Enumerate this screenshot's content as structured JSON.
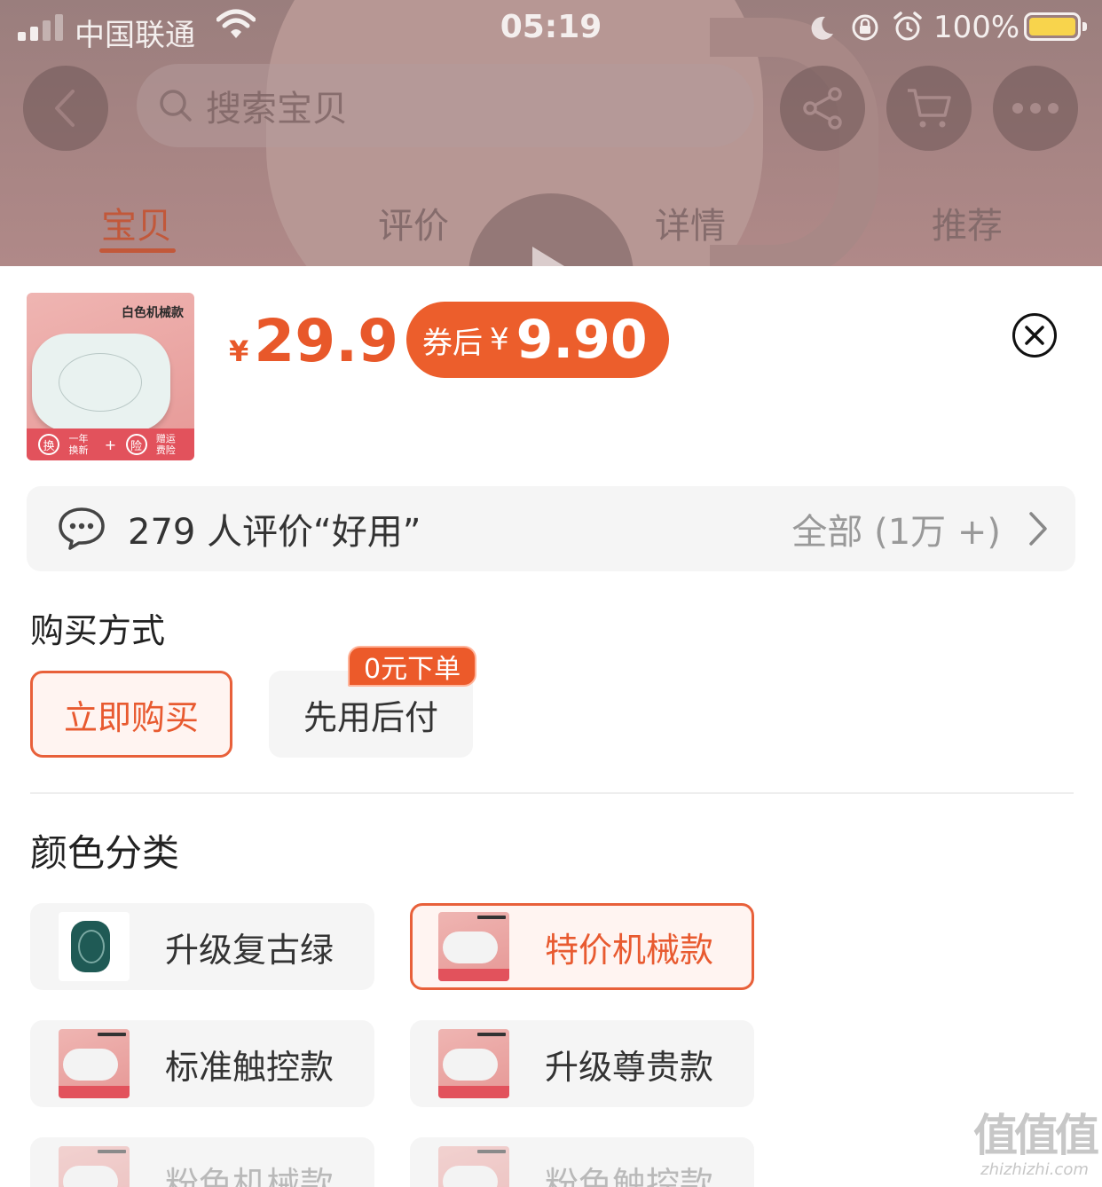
{
  "status_bar": {
    "carrier": "中国联通",
    "time": "05:19",
    "battery_percent": "100%"
  },
  "nav": {
    "search_placeholder": "搜索宝贝"
  },
  "tabs": [
    {
      "label": "宝贝",
      "active": true
    },
    {
      "label": "评价",
      "active": false
    },
    {
      "label": "详情",
      "active": false
    },
    {
      "label": "推荐",
      "active": false
    }
  ],
  "product": {
    "thumb_caption": "白色机械款",
    "thumb_badge_1": "换",
    "thumb_badge_1_text": "一年换新",
    "thumb_badge_2": "险",
    "thumb_badge_2_text": "赠运费险",
    "currency": "¥",
    "price": "29.9",
    "coupon_label": "券后",
    "coupon_price": "9.90"
  },
  "reviews": {
    "summary": "279 人评价“好用”",
    "all_label": "全部 (1万 +)"
  },
  "purchase": {
    "title": "购买方式",
    "options": [
      {
        "label": "立即购买",
        "selected": true
      },
      {
        "label": "先用后付",
        "selected": false
      }
    ],
    "pay_later_badge": "0元下单"
  },
  "colors": {
    "title": "颜色分类",
    "variants": [
      {
        "label": "升级复古绿",
        "thumb": "green-pad",
        "selected": false
      },
      {
        "label": "特价机械款",
        "thumb": "white-mechanical",
        "selected": true
      },
      {
        "label": "标准触控款",
        "thumb": "white-touch",
        "selected": false
      },
      {
        "label": "升级尊贵款",
        "thumb": "white-premium",
        "selected": false
      },
      {
        "label": "粉色机械款",
        "thumb": "pink-mechanical",
        "selected": false
      },
      {
        "label": "粉色触控款",
        "thumb": "pink-touch",
        "selected": false
      }
    ]
  },
  "watermark": {
    "big": "值值值",
    "small": "zhizhizhi.com"
  },
  "colors_theme": {
    "accent": "#e8582a",
    "coupon_bg": "#ec5e2c",
    "battery": "#f8d44c"
  },
  "icons": [
    "back-icon",
    "search-icon",
    "share-icon",
    "cart-icon",
    "more-icon",
    "close-icon",
    "chat-bubble-icon",
    "chevron-right-icon",
    "play-icon"
  ]
}
